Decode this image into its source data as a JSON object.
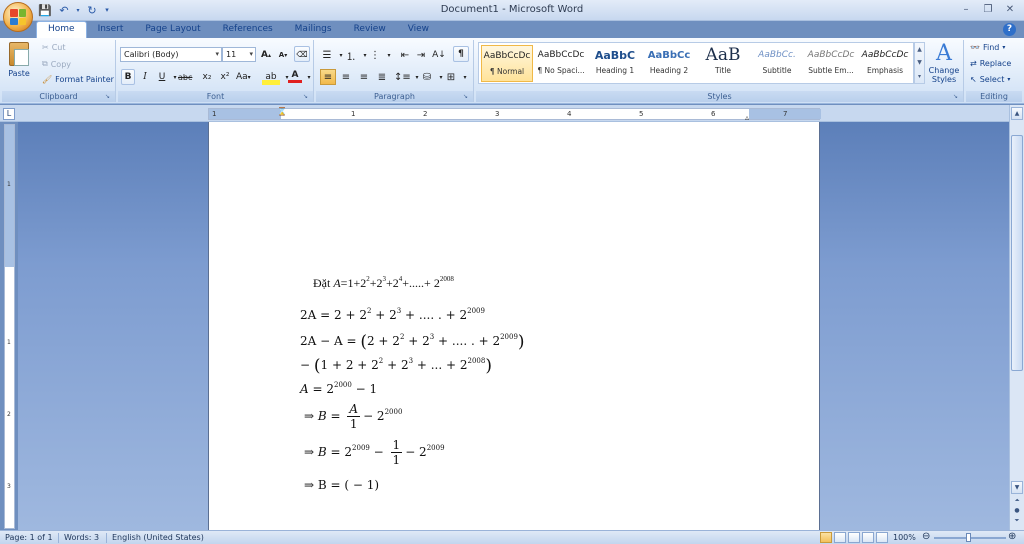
{
  "window": {
    "title": "Document1 - Microsoft Word",
    "controls": {
      "minimize": "–",
      "restore": "❐",
      "close": "✕"
    }
  },
  "tabs": [
    "Home",
    "Insert",
    "Page Layout",
    "References",
    "Mailings",
    "Review",
    "View"
  ],
  "active_tab": "Home",
  "clipboard": {
    "label": "Clipboard",
    "paste": "Paste",
    "cut": "Cut",
    "copy": "Copy",
    "format_painter": "Format Painter"
  },
  "font": {
    "label": "Font",
    "family": "Calibri (Body)",
    "size": "11",
    "bold": "B",
    "italic": "I",
    "underline": "U",
    "strikethrough": "abc",
    "subscript": "x₂",
    "superscript": "x²",
    "change_case": "Aa",
    "grow": "A",
    "shrink": "A"
  },
  "paragraph": {
    "label": "Paragraph",
    "show_marks": "¶"
  },
  "styles": {
    "label": "Styles",
    "items": [
      {
        "sample": "AaBbCcDc",
        "name": "¶ Normal",
        "selected": true
      },
      {
        "sample": "AaBbCcDc",
        "name": "¶ No Spaci..."
      },
      {
        "sample": "AaBbC",
        "name": "Heading 1"
      },
      {
        "sample": "AaBbCc",
        "name": "Heading 2"
      },
      {
        "sample": "AaB",
        "name": "Title"
      },
      {
        "sample": "AaBbCc.",
        "name": "Subtitle"
      },
      {
        "sample": "AaBbCcDc",
        "name": "Subtle Em..."
      },
      {
        "sample": "AaBbCcDc",
        "name": "Emphasis"
      }
    ],
    "change_styles": "Change Styles"
  },
  "editing": {
    "label": "Editing",
    "find": "Find",
    "replace": "Replace",
    "select": "Select"
  },
  "ruler": {
    "numbers": [
      "1",
      "2",
      "1",
      "2",
      "3",
      "4",
      "5",
      "6",
      "7"
    ],
    "v_numbers": [
      "1",
      "2",
      "1",
      "2",
      "3",
      "4",
      "5",
      "6"
    ]
  },
  "document": {
    "intro_word": "Đặt",
    "lines": {
      "l1_lhs": "2A",
      "l2_lhs": "2A − A",
      "l4_lhs": "A",
      "l5_var": "B",
      "l5_num": "A",
      "l5_den": "1",
      "l6_var": "B",
      "l6_num": "1",
      "l6_den": "1",
      "l7": "⇒ B = ( − 1)"
    }
  },
  "status": {
    "page": "Page: 1 of 1",
    "words": "Words: 3",
    "language": "English (United States)",
    "zoom": "100%"
  }
}
